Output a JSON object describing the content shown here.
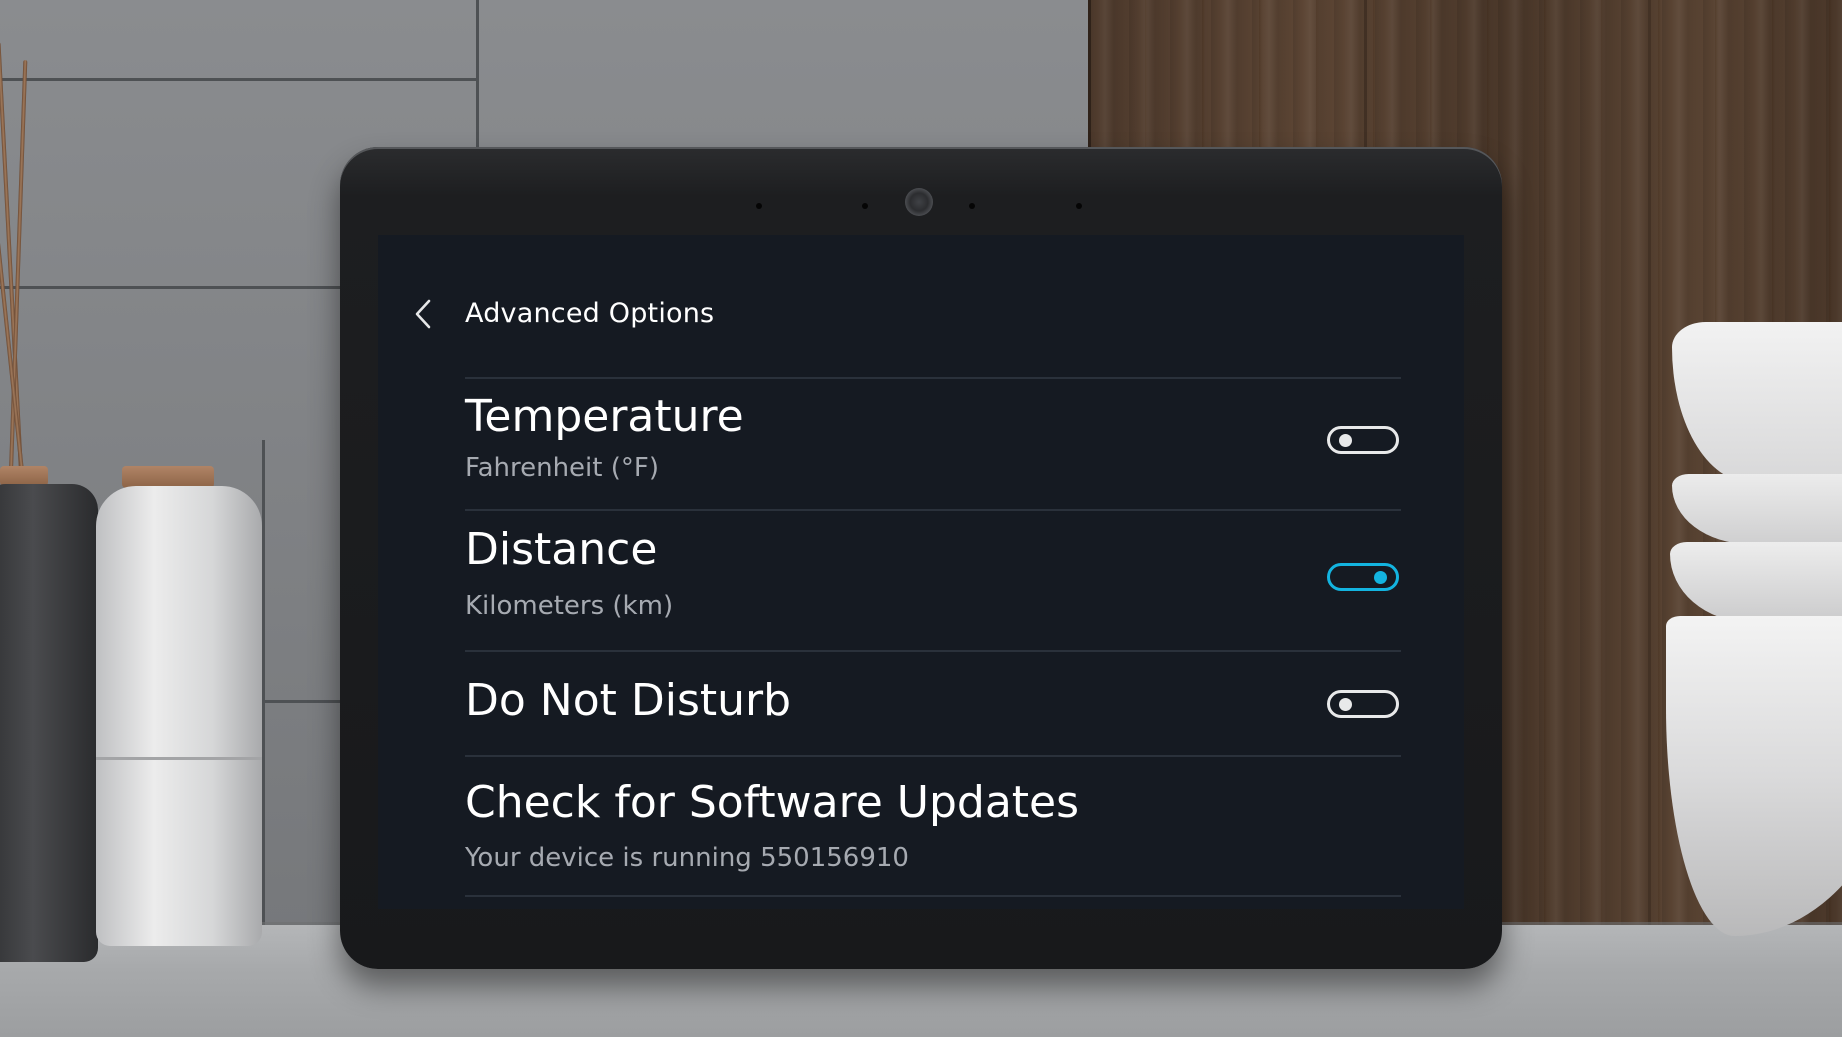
{
  "screen": {
    "title": "Advanced Options",
    "back_icon": "chevron-left-icon"
  },
  "settings": [
    {
      "title": "Temperature",
      "subtitle": "Fahrenheit (°F)",
      "toggle": "off"
    },
    {
      "title": "Distance",
      "subtitle": "Kilometers (km)",
      "toggle": "on"
    },
    {
      "title": "Do Not Disturb",
      "subtitle": "",
      "toggle": "off"
    },
    {
      "title": "Check for Software Updates",
      "subtitle": "Your device is running 550156910"
    }
  ],
  "colors": {
    "screen_background": "#151a22",
    "toggle_on": "#13b4e0",
    "toggle_off": "#e8e9ea",
    "subtitle_text": "#a6aab1"
  }
}
